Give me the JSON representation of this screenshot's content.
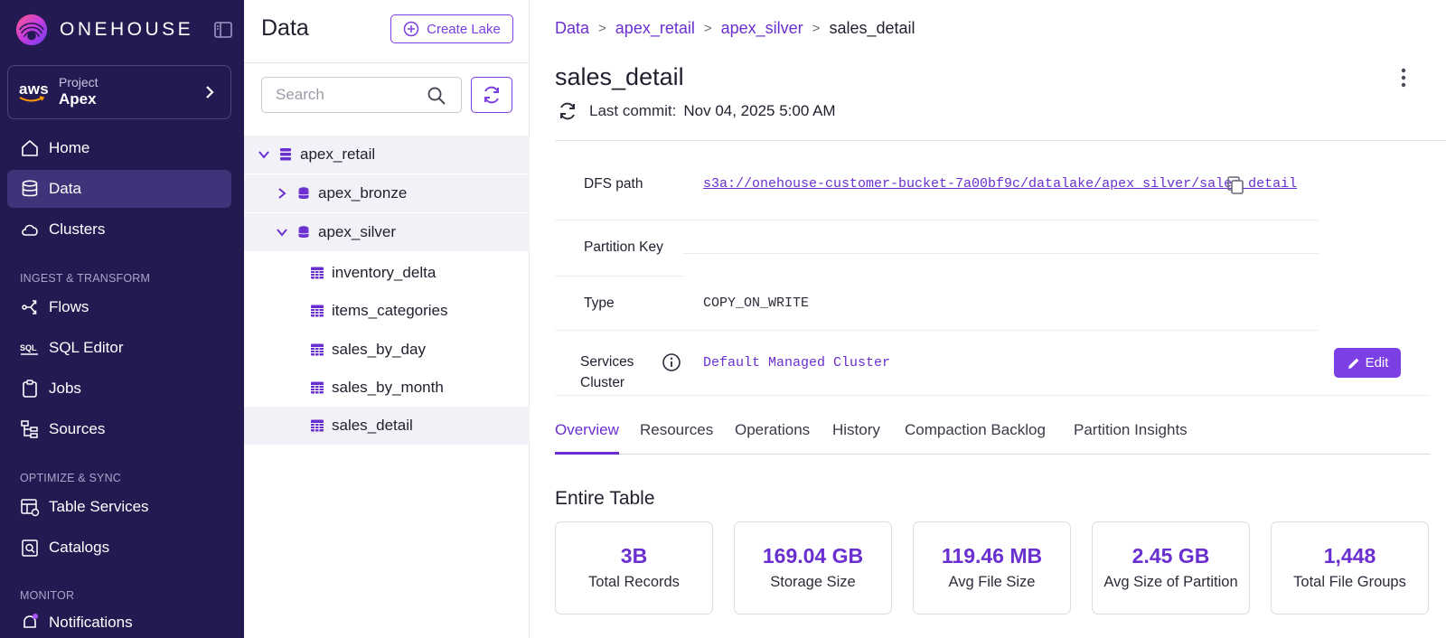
{
  "brand": {
    "name": "ONEHOUSE",
    "accent": "#7b3fe4",
    "sidebar_bg": "#241a52"
  },
  "project": {
    "label": "Project",
    "name": "Apex",
    "provider": "aws"
  },
  "nav": {
    "items": [
      {
        "label": "Home",
        "icon": "home-icon"
      },
      {
        "label": "Data",
        "icon": "database-icon",
        "active": true
      },
      {
        "label": "Clusters",
        "icon": "cloud-icon"
      },
      {
        "label": "Flows",
        "icon": "flows-icon"
      },
      {
        "label": "SQL Editor",
        "icon": "sql-icon"
      },
      {
        "label": "Jobs",
        "icon": "clipboard-icon"
      },
      {
        "label": "Sources",
        "icon": "sources-icon"
      },
      {
        "label": "Table Services",
        "icon": "table-services-icon"
      },
      {
        "label": "Catalogs",
        "icon": "catalog-icon"
      },
      {
        "label": "Notifications",
        "icon": "bell-icon"
      }
    ],
    "sections": [
      "INGEST & TRANSFORM",
      "OPTIMIZE & SYNC",
      "MONITOR"
    ]
  },
  "tree_panel": {
    "title": "Data",
    "create_label": "Create Lake",
    "search_placeholder": "Search",
    "nodes": [
      {
        "label": "apex_retail",
        "expanded": true
      },
      {
        "label": "apex_bronze",
        "expanded": false
      },
      {
        "label": "apex_silver",
        "expanded": true
      },
      {
        "label": "inventory_delta"
      },
      {
        "label": "items_categories"
      },
      {
        "label": "sales_by_day"
      },
      {
        "label": "sales_by_month"
      },
      {
        "label": "sales_detail",
        "selected": true
      }
    ]
  },
  "breadcrumb": [
    "Data",
    "apex_retail",
    "apex_silver",
    "sales_detail"
  ],
  "breadcrumb_sep": ">",
  "table": {
    "title": "sales_detail",
    "commit_label": "Last commit:",
    "commit_value": "Nov 04, 2025 5:00 AM"
  },
  "properties": {
    "dfs_label": "DFS path",
    "dfs_value": "s3a://onehouse-customer-bucket-7a00bf9c/datalake/apex_silver/sales_detail",
    "partition_label": "Partition Key",
    "partition_value": "",
    "type_label": "Type",
    "type_value": "COPY_ON_WRITE",
    "cluster_label_1": "Services",
    "cluster_label_2": "Cluster",
    "cluster_value": "Default Managed Cluster",
    "edit_label": "Edit"
  },
  "tabs": [
    "Overview",
    "Resources",
    "Operations",
    "History",
    "Compaction Backlog",
    "Partition Insights"
  ],
  "section_title": "Entire Table",
  "stats": [
    {
      "value": "3B",
      "label": "Total Records"
    },
    {
      "value": "169.04 GB",
      "label": "Storage Size"
    },
    {
      "value": "119.46 MB",
      "label": "Avg File Size"
    },
    {
      "value": "2.45 GB",
      "label": "Avg Size of Partition"
    },
    {
      "value": "1,448",
      "label": "Total File Groups"
    }
  ]
}
